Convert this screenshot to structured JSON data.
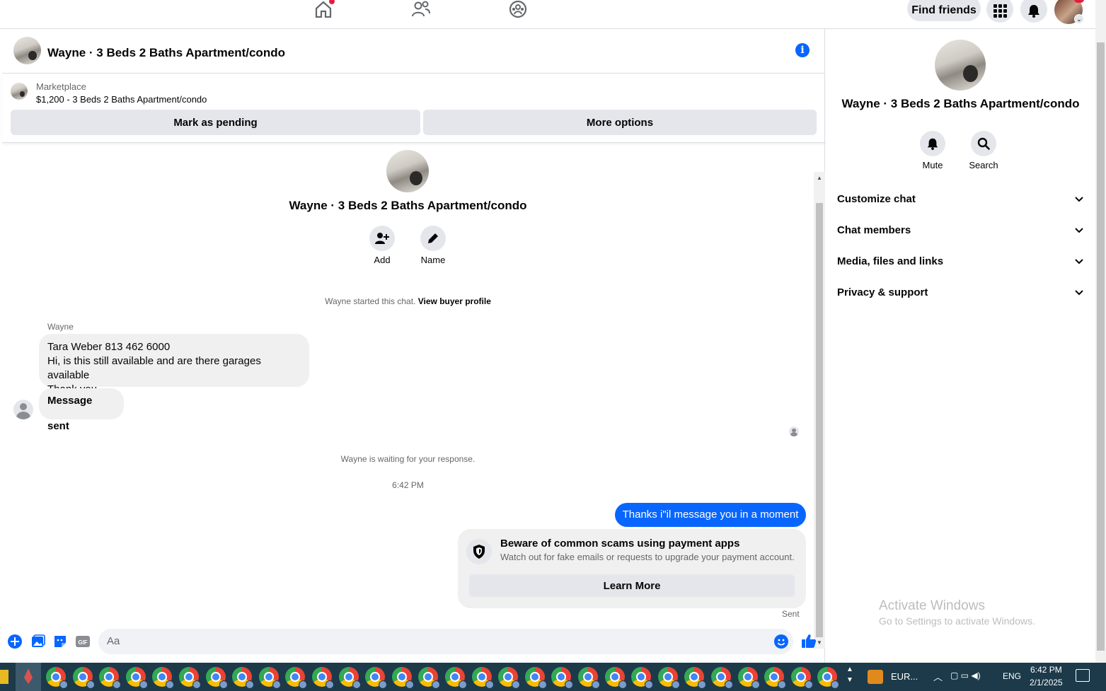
{
  "topnav": {
    "find_friends": "Find friends"
  },
  "chat": {
    "header_title": "Wayne · 3 Beds 2 Baths Apartment/condo",
    "marketplace_label": "Marketplace",
    "listing": "$1,200 - 3 Beds 2 Baths Apartment/condo",
    "mark_pending": "Mark as pending",
    "more_options": "More options",
    "intro_title": "Wayne · 3 Beds 2 Baths Apartment/condo",
    "add_label": "Add",
    "name_label": "Name",
    "started_text": "Wayne started this chat.",
    "view_buyer_profile": "View buyer profile",
    "sender_name": "Wayne",
    "message1_line1": "Tara Weber  813 462 6000",
    "message1_line2": "Hi, is this still available and are there garages available",
    "message1_line3": "Thank you.",
    "message2": "Message sent",
    "waiting": "Wayne is waiting for your response.",
    "timestamp": "6:42 PM",
    "my_message": "Thanks i\"il message you in a moment",
    "scam_title": "Beware of common scams using payment apps",
    "scam_body": "Watch out for fake emails or requests to upgrade your payment account.",
    "learn_more": "Learn More",
    "sent_status": "Sent",
    "composer_placeholder": "Aa"
  },
  "panel": {
    "title": "Wayne · 3 Beds 2 Baths Apartment/condo",
    "mute": "Mute",
    "search": "Search",
    "rows": [
      "Customize chat",
      "Chat members",
      "Media, files and links",
      "Privacy & support"
    ]
  },
  "watermark": {
    "line1": "Activate Windows",
    "line2": "Go to Settings to activate Windows."
  },
  "taskbar": {
    "currency": "EUR...",
    "lang": "ENG",
    "time": "6:42 PM",
    "date": "2/1/2025"
  },
  "colors": {
    "accent": "#0866ff",
    "bubble_gray": "#f0f0f0",
    "button_gray": "#e4e6eb",
    "taskbar": "#1c3a4a"
  }
}
